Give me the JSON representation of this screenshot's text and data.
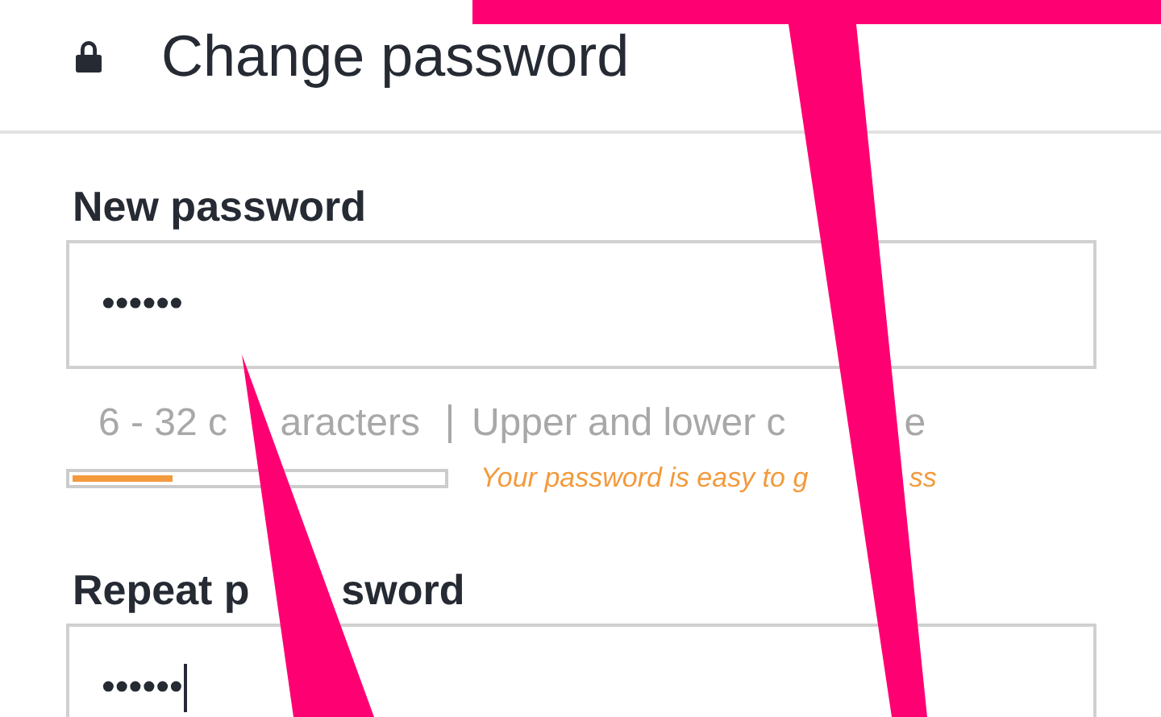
{
  "header": {
    "title": "Change password"
  },
  "fields": [
    {
      "label": [
        "New password"
      ],
      "value": "••••••",
      "focused": false
    },
    {
      "label": [
        "Repeat p",
        "sword"
      ],
      "value": "••••••",
      "focused": true
    }
  ],
  "hints": [
    [
      "6 - 32 c",
      "aracters"
    ],
    [
      "Upper and lower c",
      "e"
    ]
  ],
  "strength": {
    "level": 0.27,
    "message": [
      "Your password is easy to g",
      "ss"
    ]
  }
}
